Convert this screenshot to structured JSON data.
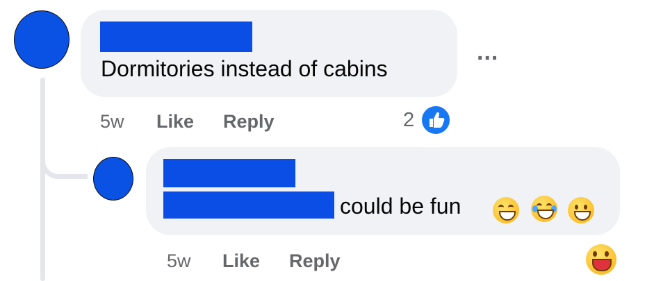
{
  "comment": {
    "text": "Dormitories instead of cabins",
    "time": "5w",
    "like_label": "Like",
    "reply_label": "Reply",
    "reaction_count": "2",
    "reaction_icon": "thumbs-up-icon",
    "more_label": "..."
  },
  "reply": {
    "text": "could be fun",
    "inline_emojis": [
      "grinning-squinting-icon",
      "tears-of-joy-icon",
      "grinning-face-icon"
    ],
    "time": "5w",
    "like_label": "Like",
    "reply_label": "Reply",
    "reaction_icon": "big-grin-icon"
  },
  "colors": {
    "bubble": "#f0f2f5",
    "redaction": "#0a4ee6",
    "avatar": "#0a52e4",
    "meta_text": "#65676b",
    "like_blue": "#1877f2"
  }
}
